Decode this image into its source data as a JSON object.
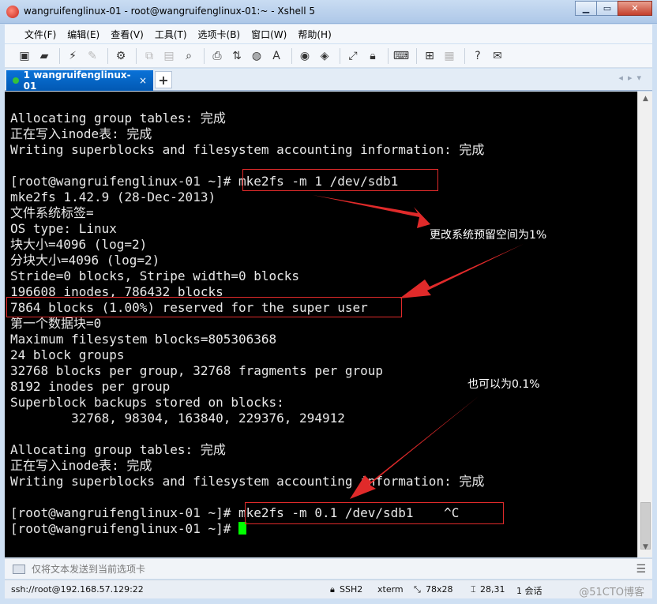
{
  "window": {
    "title": "wangruifenglinux-01 - root@wangruifenglinux-01:~ - Xshell 5"
  },
  "menu": [
    "文件(F)",
    "编辑(E)",
    "查看(V)",
    "工具(T)",
    "选项卡(B)",
    "窗口(W)",
    "帮助(H)"
  ],
  "tab": {
    "label": "1 wangruifenglinux-01",
    "close": "×",
    "add": "+"
  },
  "terminal": {
    "lines": [
      "Allocating group tables: 完成",
      "正在写入inode表: 完成",
      "Writing superblocks and filesystem accounting information: 完成",
      "",
      "[root@wangruifenglinux-01 ~]# mke2fs -m 1 /dev/sdb1",
      "mke2fs 1.42.9 (28-Dec-2013)",
      "文件系统标签=",
      "OS type: Linux",
      "块大小=4096 (log=2)",
      "分块大小=4096 (log=2)",
      "Stride=0 blocks, Stripe width=0 blocks",
      "196608 inodes, 786432 blocks",
      "7864 blocks (1.00%) reserved for the super user",
      "第一个数据块=0",
      "Maximum filesystem blocks=805306368",
      "24 block groups",
      "32768 blocks per group, 32768 fragments per group",
      "8192 inodes per group",
      "Superblock backups stored on blocks:",
      "        32768, 98304, 163840, 229376, 294912",
      "",
      "Allocating group tables: 完成",
      "正在写入inode表: 完成",
      "Writing superblocks and filesystem accounting information: 完成",
      "",
      "[root@wangruifenglinux-01 ~]# mke2fs -m 0.1 /dev/sdb1    ^C",
      "[root@wangruifenglinux-01 ~]# "
    ],
    "annotation_1": "更改系统预留空间为1%",
    "annotation_2": "也可以为0.1%",
    "highlight_color": "#e02a2a",
    "cursor_color": "#00ff00"
  },
  "sendbar": {
    "placeholder": "仅将文本发送到当前选项卡",
    "menu_icon": "☰"
  },
  "status": {
    "connection": "ssh://root@192.168.57.129:22",
    "protocol": "SSH2",
    "term": "xterm",
    "size": "78x28",
    "cursor_pos": "28,31",
    "sessions": "1 会话"
  },
  "watermark": "@51CTO博客"
}
